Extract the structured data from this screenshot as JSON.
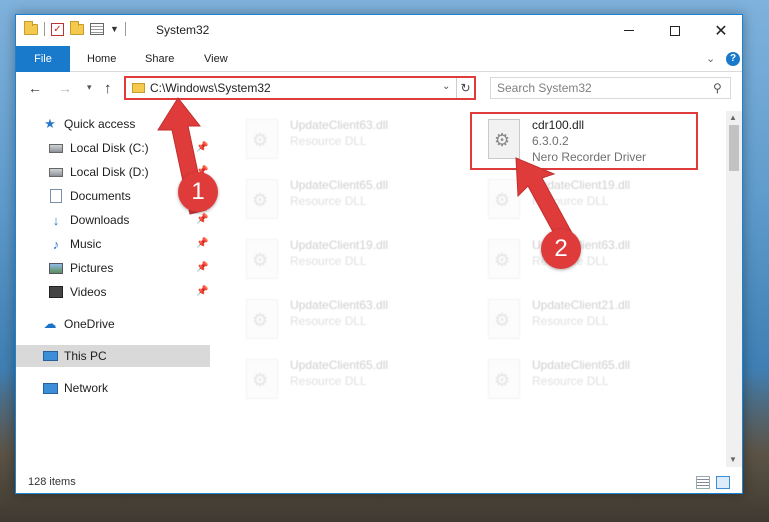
{
  "window": {
    "title": "System32",
    "help_label": "?"
  },
  "ribbon": {
    "tabs": [
      {
        "label": "File"
      },
      {
        "label": "Home"
      },
      {
        "label": "Share"
      },
      {
        "label": "View"
      }
    ]
  },
  "nav": {
    "address": "C:\\Windows\\System32",
    "search_placeholder": "Search System32"
  },
  "sidebar": {
    "items": [
      {
        "label": "Quick access",
        "icon": "star-icon",
        "pinned": false
      },
      {
        "label": "Local Disk (C:)",
        "icon": "drive-icon",
        "pinned": true
      },
      {
        "label": "Local Disk (D:)",
        "icon": "drive-icon",
        "pinned": true
      },
      {
        "label": "Documents",
        "icon": "documents-icon",
        "pinned": true
      },
      {
        "label": "Downloads",
        "icon": "downloads-icon",
        "pinned": true
      },
      {
        "label": "Music",
        "icon": "music-icon",
        "pinned": true
      },
      {
        "label": "Pictures",
        "icon": "pictures-icon",
        "pinned": true
      },
      {
        "label": "Videos",
        "icon": "videos-icon",
        "pinned": true
      },
      {
        "label": "OneDrive",
        "icon": "onedrive-icon",
        "pinned": false
      },
      {
        "label": "This PC",
        "icon": "this-pc-icon",
        "pinned": false,
        "selected": true
      },
      {
        "label": "Network",
        "icon": "network-icon",
        "pinned": false
      }
    ]
  },
  "files": {
    "highlighted": {
      "name": "cdr100.dll",
      "version": "6.3.0.2",
      "description": "Nero Recorder Driver"
    },
    "ghost_left": [
      {
        "name": "UpdateClient63.dll",
        "desc": "Resource DLL"
      },
      {
        "name": "UpdateClient65.dll",
        "desc": "Resource DLL"
      },
      {
        "name": "UpdateClient19.dll",
        "desc": "Resource DLL"
      },
      {
        "name": "UpdateClient63.dll",
        "desc": "Resource DLL"
      },
      {
        "name": "UpdateClient65.dll",
        "desc": "Resource DLL"
      }
    ],
    "ghost_right": [
      {
        "name": "UpdateClient19.dll",
        "desc": "Resource DLL"
      },
      {
        "name": "UpdateClient63.dll",
        "desc": "Resource DLL"
      },
      {
        "name": "UpdateClient21.dll",
        "desc": "Resource DLL"
      },
      {
        "name": "UpdateClient65.dll",
        "desc": "Resource DLL"
      }
    ]
  },
  "status": {
    "item_count": "128 items"
  },
  "annotations": {
    "step1": "1",
    "step2": "2",
    "accent": "#e03b3b"
  },
  "colors": {
    "file_tab": "#1979ca",
    "selection": "#d9d9d9"
  }
}
